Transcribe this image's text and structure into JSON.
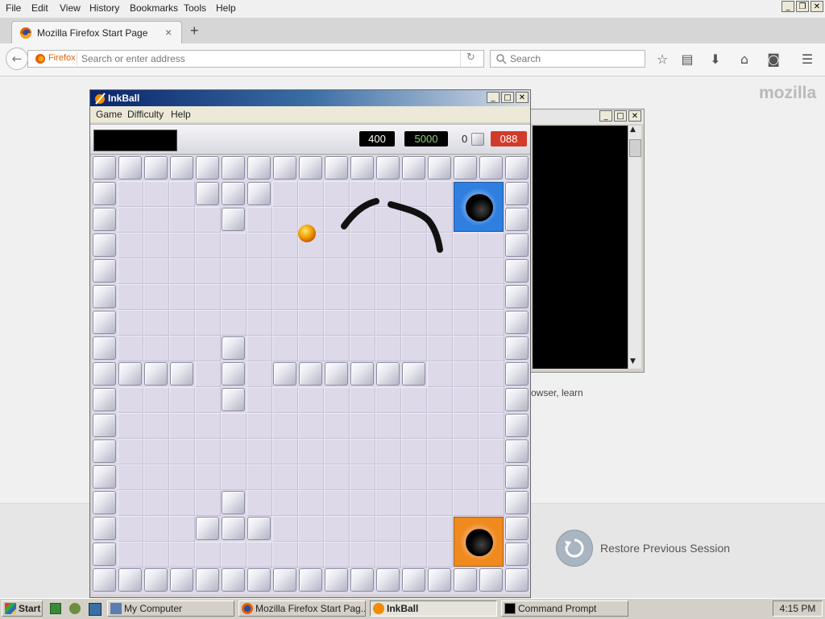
{
  "firefox": {
    "menu": [
      "File",
      "Edit",
      "View",
      "History",
      "Bookmarks",
      "Tools",
      "Help"
    ],
    "tab_title": "Mozilla Firefox Start Page",
    "new_tab": "+",
    "tab_close": "×",
    "identity_label": "Firefox",
    "address_placeholder": "Search or enter address",
    "search_placeholder": "Search",
    "brand": "mozilla",
    "page_fragment": "owser, learn",
    "restore_session_label": "Restore Previous Session"
  },
  "inkball": {
    "title": "InkBall",
    "menu": [
      "Game",
      "Difficulty",
      "Help"
    ],
    "score": "400",
    "target": "5000",
    "spare_count": "0",
    "timer": "088",
    "colors": {
      "timer_bg": "#d23b2a",
      "blue_hole": "#2f7fe0",
      "orange_hole": "#f08a1e",
      "ball": "#f5a300",
      "ink": "#111111"
    }
  },
  "command_prompt": {
    "title": ""
  },
  "taskbar": {
    "start_label": "Start",
    "tasks": [
      "My Computer",
      "Mozilla Firefox Start Pag...",
      "InkBall",
      "Command Prompt"
    ],
    "clock": "4:15 PM"
  }
}
